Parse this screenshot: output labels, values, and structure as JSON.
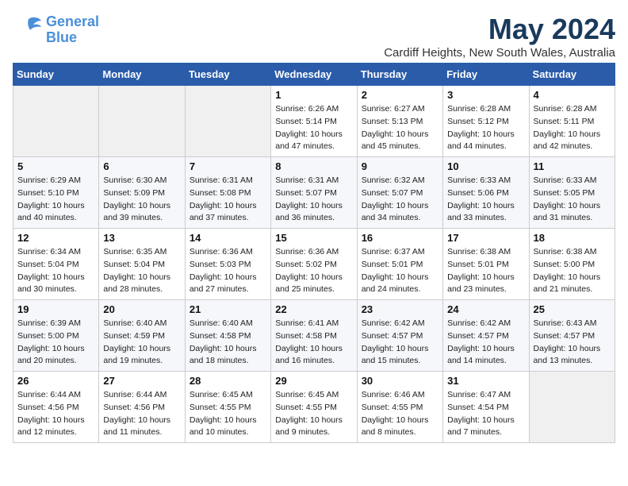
{
  "header": {
    "logo_line1": "General",
    "logo_line2": "Blue",
    "title": "May 2024",
    "subtitle": "Cardiff Heights, New South Wales, Australia"
  },
  "weekdays": [
    "Sunday",
    "Monday",
    "Tuesday",
    "Wednesday",
    "Thursday",
    "Friday",
    "Saturday"
  ],
  "weeks": [
    [
      {
        "day": "",
        "info": ""
      },
      {
        "day": "",
        "info": ""
      },
      {
        "day": "",
        "info": ""
      },
      {
        "day": "1",
        "info": "Sunrise: 6:26 AM\nSunset: 5:14 PM\nDaylight: 10 hours and 47 minutes."
      },
      {
        "day": "2",
        "info": "Sunrise: 6:27 AM\nSunset: 5:13 PM\nDaylight: 10 hours and 45 minutes."
      },
      {
        "day": "3",
        "info": "Sunrise: 6:28 AM\nSunset: 5:12 PM\nDaylight: 10 hours and 44 minutes."
      },
      {
        "day": "4",
        "info": "Sunrise: 6:28 AM\nSunset: 5:11 PM\nDaylight: 10 hours and 42 minutes."
      }
    ],
    [
      {
        "day": "5",
        "info": "Sunrise: 6:29 AM\nSunset: 5:10 PM\nDaylight: 10 hours and 40 minutes."
      },
      {
        "day": "6",
        "info": "Sunrise: 6:30 AM\nSunset: 5:09 PM\nDaylight: 10 hours and 39 minutes."
      },
      {
        "day": "7",
        "info": "Sunrise: 6:31 AM\nSunset: 5:08 PM\nDaylight: 10 hours and 37 minutes."
      },
      {
        "day": "8",
        "info": "Sunrise: 6:31 AM\nSunset: 5:07 PM\nDaylight: 10 hours and 36 minutes."
      },
      {
        "day": "9",
        "info": "Sunrise: 6:32 AM\nSunset: 5:07 PM\nDaylight: 10 hours and 34 minutes."
      },
      {
        "day": "10",
        "info": "Sunrise: 6:33 AM\nSunset: 5:06 PM\nDaylight: 10 hours and 33 minutes."
      },
      {
        "day": "11",
        "info": "Sunrise: 6:33 AM\nSunset: 5:05 PM\nDaylight: 10 hours and 31 minutes."
      }
    ],
    [
      {
        "day": "12",
        "info": "Sunrise: 6:34 AM\nSunset: 5:04 PM\nDaylight: 10 hours and 30 minutes."
      },
      {
        "day": "13",
        "info": "Sunrise: 6:35 AM\nSunset: 5:04 PM\nDaylight: 10 hours and 28 minutes."
      },
      {
        "day": "14",
        "info": "Sunrise: 6:36 AM\nSunset: 5:03 PM\nDaylight: 10 hours and 27 minutes."
      },
      {
        "day": "15",
        "info": "Sunrise: 6:36 AM\nSunset: 5:02 PM\nDaylight: 10 hours and 25 minutes."
      },
      {
        "day": "16",
        "info": "Sunrise: 6:37 AM\nSunset: 5:01 PM\nDaylight: 10 hours and 24 minutes."
      },
      {
        "day": "17",
        "info": "Sunrise: 6:38 AM\nSunset: 5:01 PM\nDaylight: 10 hours and 23 minutes."
      },
      {
        "day": "18",
        "info": "Sunrise: 6:38 AM\nSunset: 5:00 PM\nDaylight: 10 hours and 21 minutes."
      }
    ],
    [
      {
        "day": "19",
        "info": "Sunrise: 6:39 AM\nSunset: 5:00 PM\nDaylight: 10 hours and 20 minutes."
      },
      {
        "day": "20",
        "info": "Sunrise: 6:40 AM\nSunset: 4:59 PM\nDaylight: 10 hours and 19 minutes."
      },
      {
        "day": "21",
        "info": "Sunrise: 6:40 AM\nSunset: 4:58 PM\nDaylight: 10 hours and 18 minutes."
      },
      {
        "day": "22",
        "info": "Sunrise: 6:41 AM\nSunset: 4:58 PM\nDaylight: 10 hours and 16 minutes."
      },
      {
        "day": "23",
        "info": "Sunrise: 6:42 AM\nSunset: 4:57 PM\nDaylight: 10 hours and 15 minutes."
      },
      {
        "day": "24",
        "info": "Sunrise: 6:42 AM\nSunset: 4:57 PM\nDaylight: 10 hours and 14 minutes."
      },
      {
        "day": "25",
        "info": "Sunrise: 6:43 AM\nSunset: 4:57 PM\nDaylight: 10 hours and 13 minutes."
      }
    ],
    [
      {
        "day": "26",
        "info": "Sunrise: 6:44 AM\nSunset: 4:56 PM\nDaylight: 10 hours and 12 minutes."
      },
      {
        "day": "27",
        "info": "Sunrise: 6:44 AM\nSunset: 4:56 PM\nDaylight: 10 hours and 11 minutes."
      },
      {
        "day": "28",
        "info": "Sunrise: 6:45 AM\nSunset: 4:55 PM\nDaylight: 10 hours and 10 minutes."
      },
      {
        "day": "29",
        "info": "Sunrise: 6:45 AM\nSunset: 4:55 PM\nDaylight: 10 hours and 9 minutes."
      },
      {
        "day": "30",
        "info": "Sunrise: 6:46 AM\nSunset: 4:55 PM\nDaylight: 10 hours and 8 minutes."
      },
      {
        "day": "31",
        "info": "Sunrise: 6:47 AM\nSunset: 4:54 PM\nDaylight: 10 hours and 7 minutes."
      },
      {
        "day": "",
        "info": ""
      }
    ]
  ]
}
